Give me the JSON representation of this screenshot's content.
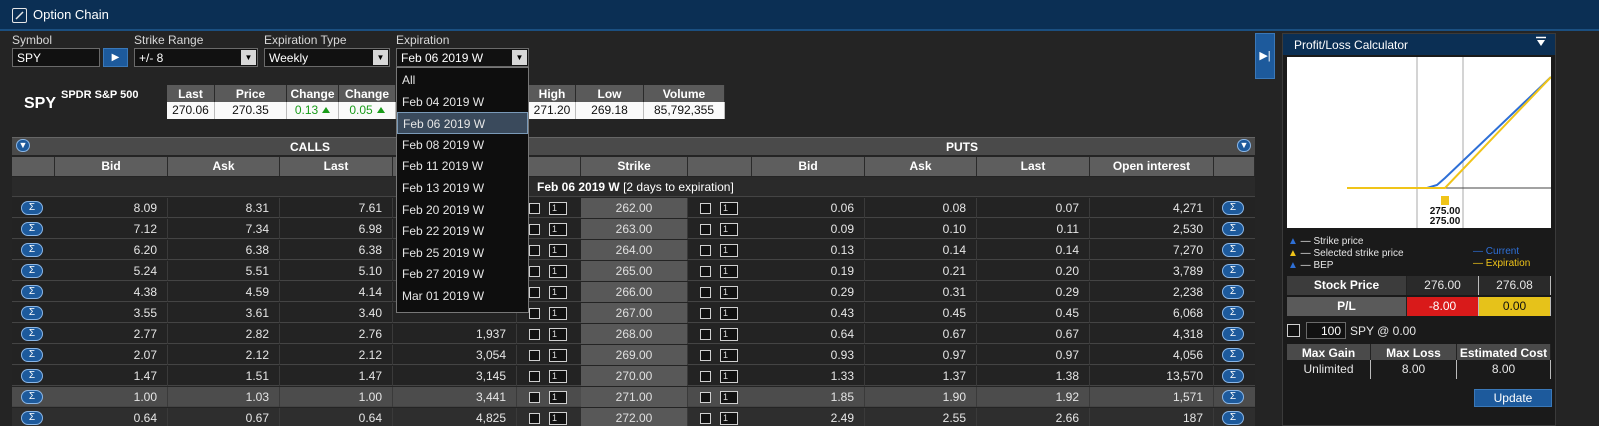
{
  "window": {
    "title": "Option Chain"
  },
  "form": {
    "symbol_label": "Symbol",
    "symbol_value": "SPY",
    "strike_range_label": "Strike Range",
    "strike_range_value": "+/- 8",
    "exp_type_label": "Expiration Type",
    "exp_type_value": "Weekly",
    "expiration_label": "Expiration",
    "expiration_value": "Feb 06 2019 W"
  },
  "quote": {
    "symbol": "SPY",
    "description": "SPDR S&P 500",
    "headers": [
      "Last",
      "Price",
      "Change",
      "Change %",
      "High",
      "Low",
      "Volume"
    ],
    "last": "270.06",
    "price": "270.35",
    "change": "0.13",
    "change_pct": "0.05",
    "high": "271.20",
    "low": "269.18",
    "volume": "85,792,355"
  },
  "chain": {
    "calls_label": "CALLS",
    "puts_label": "PUTS",
    "call_headers": [
      "Bid",
      "Ask",
      "Last"
    ],
    "strike_header": "Strike",
    "put_headers": [
      "Bid",
      "Ask",
      "Last",
      "Open interest"
    ],
    "expiry_bold": "Feb 06 2019 W",
    "expiry_note": "[2 days to expiration]",
    "qty_default": "1",
    "sigma": "Σ",
    "rows": [
      {
        "c_bid": "8.09",
        "c_ask": "8.31",
        "c_last": "7.61",
        "c_oi": "",
        "strike": "262.00",
        "p_bid": "0.06",
        "p_ask": "0.08",
        "p_last": "0.07",
        "p_oi": "4,271"
      },
      {
        "c_bid": "7.12",
        "c_ask": "7.34",
        "c_last": "6.98",
        "c_oi": "",
        "strike": "263.00",
        "p_bid": "0.09",
        "p_ask": "0.10",
        "p_last": "0.11",
        "p_oi": "2,530"
      },
      {
        "c_bid": "6.20",
        "c_ask": "6.38",
        "c_last": "6.38",
        "c_oi": "",
        "strike": "264.00",
        "p_bid": "0.13",
        "p_ask": "0.14",
        "p_last": "0.14",
        "p_oi": "7,270"
      },
      {
        "c_bid": "5.24",
        "c_ask": "5.51",
        "c_last": "5.10",
        "c_oi": "",
        "strike": "265.00",
        "p_bid": "0.19",
        "p_ask": "0.21",
        "p_last": "0.20",
        "p_oi": "3,789"
      },
      {
        "c_bid": "4.38",
        "c_ask": "4.59",
        "c_last": "4.14",
        "c_oi": "",
        "strike": "266.00",
        "p_bid": "0.29",
        "p_ask": "0.31",
        "p_last": "0.29",
        "p_oi": "2,238"
      },
      {
        "c_bid": "3.55",
        "c_ask": "3.61",
        "c_last": "3.40",
        "c_oi": "",
        "strike": "267.00",
        "p_bid": "0.43",
        "p_ask": "0.45",
        "p_last": "0.45",
        "p_oi": "6,068"
      },
      {
        "c_bid": "2.77",
        "c_ask": "2.82",
        "c_last": "2.76",
        "c_oi": "1,937",
        "strike": "268.00",
        "p_bid": "0.64",
        "p_ask": "0.67",
        "p_last": "0.67",
        "p_oi": "4,318"
      },
      {
        "c_bid": "2.07",
        "c_ask": "2.12",
        "c_last": "2.12",
        "c_oi": "3,054",
        "strike": "269.00",
        "p_bid": "0.93",
        "p_ask": "0.97",
        "p_last": "0.97",
        "p_oi": "4,056"
      },
      {
        "c_bid": "1.47",
        "c_ask": "1.51",
        "c_last": "1.47",
        "c_oi": "3,145",
        "strike": "270.00",
        "p_bid": "1.33",
        "p_ask": "1.37",
        "p_last": "1.38",
        "p_oi": "13,570"
      },
      {
        "c_bid": "1.00",
        "c_ask": "1.03",
        "c_last": "1.00",
        "c_oi": "3,441",
        "strike": "271.00",
        "p_bid": "1.85",
        "p_ask": "1.90",
        "p_last": "1.92",
        "p_oi": "1,571"
      },
      {
        "c_bid": "0.64",
        "c_ask": "0.67",
        "c_last": "0.64",
        "c_oi": "4,825",
        "strike": "272.00",
        "p_bid": "2.49",
        "p_ask": "2.55",
        "p_last": "2.66",
        "p_oi": "187"
      }
    ]
  },
  "expiration_dropdown": {
    "options": [
      "All",
      "Feb 04 2019 W",
      "Feb 06 2019 W",
      "Feb 08 2019 W",
      "Feb 11 2019 W",
      "Feb 13 2019 W",
      "Feb 20 2019 W",
      "Feb 22 2019 W",
      "Feb 25 2019 W",
      "Feb 27 2019 W",
      "Mar 01 2019 W"
    ],
    "selected": "Feb 06 2019 W"
  },
  "calculator": {
    "title": "Profit/Loss Calculator",
    "strike_label_1": "275.00",
    "strike_label_2": "275.00",
    "legend_strike": "Strike price",
    "legend_selected": "Selected strike price",
    "legend_bep": "BEP",
    "legend_current": "Current",
    "legend_expiration": "Expiration",
    "stock_price_label": "Stock Price",
    "stock_price_1": "276.00",
    "stock_price_2": "276.08",
    "pl_label": "P/L",
    "pl_1": "-8.00",
    "pl_2": "0.00",
    "qty": "100",
    "qty_suffix": "SPY @ 0.00",
    "max_gain_label": "Max Gain",
    "max_loss_label": "Max Loss",
    "est_cost_label": "Estimated Cost",
    "max_gain": "Unlimited",
    "max_loss": "8.00",
    "est_cost": "8.00",
    "update_label": "Update",
    "colors": {
      "current": "#2e6fd6",
      "expiration": "#f0c419",
      "loss": "#d91a1a",
      "zero": "#e6c21a"
    }
  }
}
